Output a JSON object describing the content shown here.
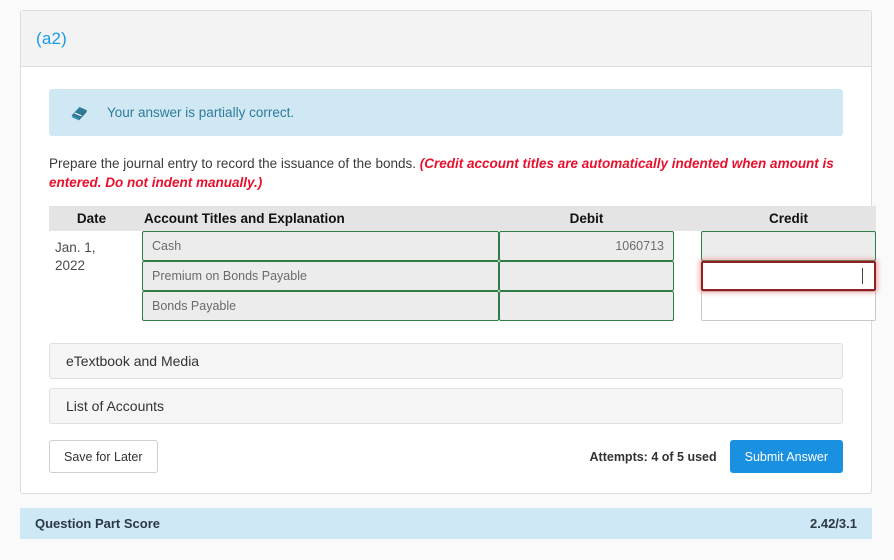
{
  "card": {
    "part_label": "(a2)"
  },
  "alert": {
    "icon": "eraser-icon",
    "message": "Your answer is partially correct."
  },
  "instruction": {
    "main": "Prepare the journal entry to record the issuance of the bonds. ",
    "emphasis": "(Credit account titles are automatically indented when amount is entered. Do not indent manually.)"
  },
  "journal": {
    "headers": {
      "date": "Date",
      "account": "Account Titles and Explanation",
      "debit": "Debit",
      "credit": "Credit"
    },
    "date": "Jan. 1,\n2022",
    "rows": [
      {
        "account": "Cash",
        "account_state": "correct",
        "debit": "1060713",
        "debit_state": "correct",
        "credit": "",
        "credit_state": "correct"
      },
      {
        "account": "Premium on Bonds Payable",
        "account_state": "correct",
        "debit": "",
        "debit_state": "correct",
        "credit": "",
        "credit_state": "error"
      },
      {
        "account": "Bonds Payable",
        "account_state": "correct",
        "debit": "",
        "debit_state": "correct",
        "credit": "",
        "credit_state": "empty"
      }
    ]
  },
  "accordions": [
    {
      "label": "eTextbook and Media"
    },
    {
      "label": "List of Accounts"
    }
  ],
  "actions": {
    "save_label": "Save for Later",
    "attempts": "Attempts: 4 of 5 used",
    "submit_label": "Submit Answer"
  },
  "score": {
    "label": "Question Part Score",
    "value": "2.42/3.1"
  },
  "colors": {
    "accent_blue": "#1a90e0",
    "link_blue": "#1a9ae8",
    "alert_bg": "#cfe8f3",
    "alert_text": "#2f7b99",
    "error_red": "#e8112d",
    "field_correct_border": "#2e7d46",
    "field_error_border": "#8d2020",
    "score_bg": "#cfe8f5"
  }
}
